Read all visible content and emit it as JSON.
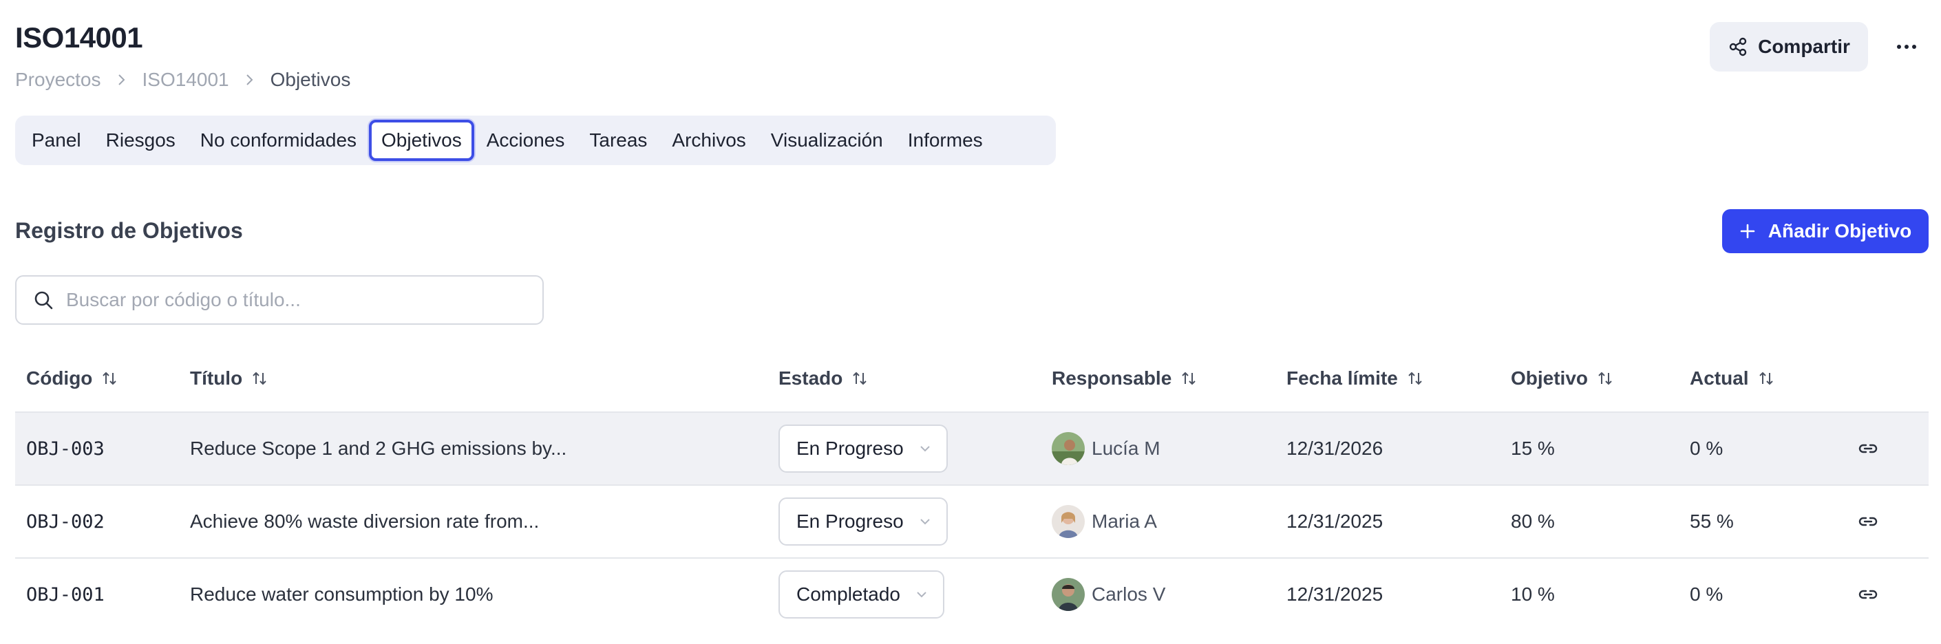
{
  "header": {
    "title": "ISO14001",
    "breadcrumb": [
      "Proyectos",
      "ISO14001",
      "Objetivos"
    ],
    "share_label": "Compartir"
  },
  "tabs": [
    {
      "label": "Panel",
      "active": false
    },
    {
      "label": "Riesgos",
      "active": false
    },
    {
      "label": "No conformidades",
      "active": false
    },
    {
      "label": "Objetivos",
      "active": true
    },
    {
      "label": "Acciones",
      "active": false
    },
    {
      "label": "Tareas",
      "active": false
    },
    {
      "label": "Archivos",
      "active": false
    },
    {
      "label": "Visualización",
      "active": false
    },
    {
      "label": "Informes",
      "active": false
    }
  ],
  "section": {
    "title": "Registro de Objetivos",
    "add_label": "Añadir Objetivo"
  },
  "search": {
    "placeholder": "Buscar por código o título...",
    "value": ""
  },
  "table": {
    "columns": [
      "Código",
      "Título",
      "Estado",
      "Responsable",
      "Fecha límite",
      "Objetivo",
      "Actual"
    ],
    "rows": [
      {
        "code": "OBJ-003",
        "title": "Reduce Scope 1 and 2 GHG emissions by...",
        "status": "En Progreso",
        "owner": "Lucía M",
        "due": "12/31/2026",
        "target": "15 %",
        "actual": "0 %"
      },
      {
        "code": "OBJ-002",
        "title": "Achieve 80% waste diversion rate from...",
        "status": "En Progreso",
        "owner": "Maria A",
        "due": "12/31/2025",
        "target": "80 %",
        "actual": "55 %"
      },
      {
        "code": "OBJ-001",
        "title": "Reduce water consumption by 10%",
        "status": "Completado",
        "owner": "Carlos V",
        "due": "12/31/2025",
        "target": "10 %",
        "actual": "0 %"
      }
    ]
  },
  "colors": {
    "accent": "#3346f0",
    "tab_active_border": "#3d4ee6",
    "row_highlight": "#f0f1f5"
  },
  "icons": {
    "share": "share-icon",
    "more": "more-horizontal-icon",
    "chevron": "chevron-right-icon",
    "search": "search-icon",
    "add": "plus-icon",
    "sort": "sort-icon",
    "dropdown": "chevron-down-icon",
    "link": "link-icon"
  }
}
